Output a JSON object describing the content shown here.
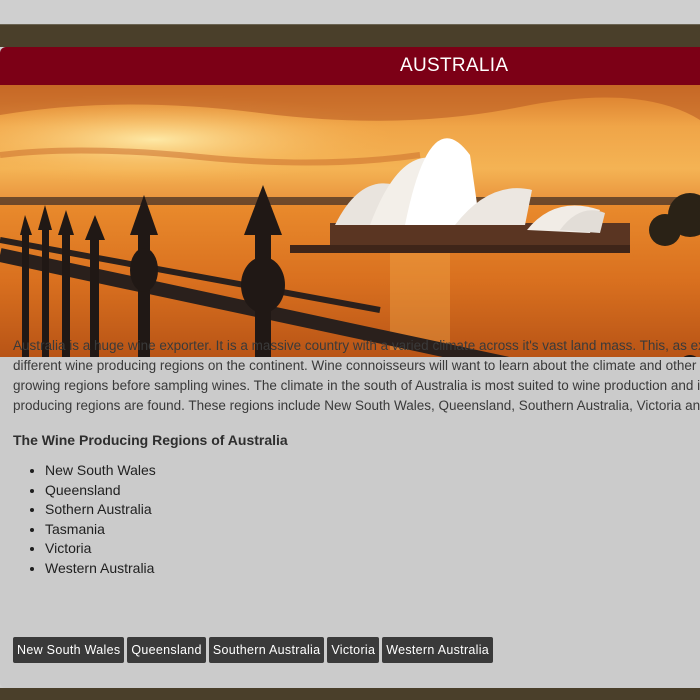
{
  "header": {
    "title": "AUSTRALIA"
  },
  "hero": {
    "image": "sydney-opera-house-sunset"
  },
  "intro": {
    "lines": [
      "Australia is a huge wine exporter. It is a massive country with a varied climate across it's vast land mass. This, as expe",
      "different wine producing regions on the continent. Wine connoisseurs will want to learn about the climate and other cha",
      "growing regions before sampling wines. The climate in the south of Australia is most suited to wine production and it is",
      "producing regions are found. These regions include New South Wales, Queensland, Southern Australia, Victoria and W"
    ]
  },
  "regions": {
    "heading": "The Wine Producing Regions of Australia",
    "items": [
      "New South Wales",
      "Queensland",
      "Sothern Australia",
      "Tasmania",
      "Victoria",
      "Western Australia"
    ]
  },
  "buttons": [
    "New South Wales",
    "Queensland",
    "Southern Australia",
    "Victoria",
    "Western Australia"
  ],
  "colors": {
    "title_bar": "#7c0016",
    "button_bg": "#3a3a3a",
    "page_bg": "#cbcbcb",
    "frame": "#4a3f2a"
  }
}
